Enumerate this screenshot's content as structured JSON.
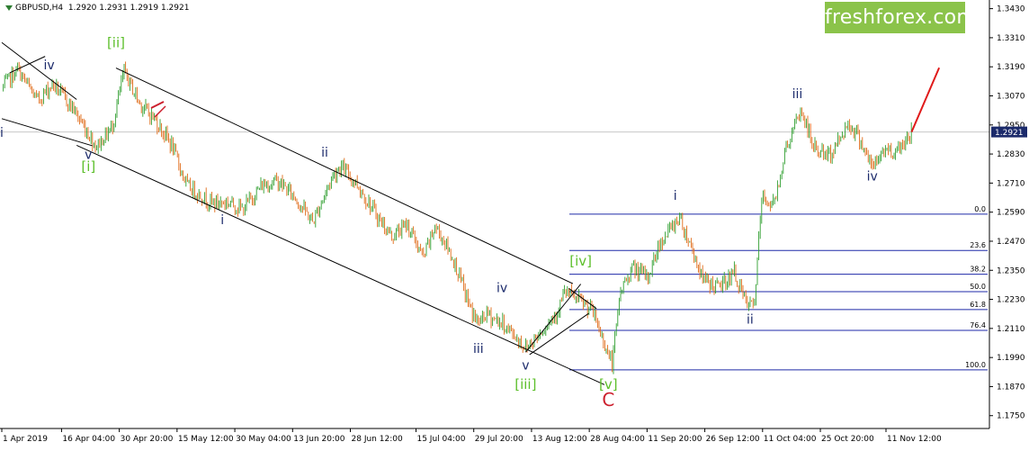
{
  "header": {
    "symbol": "GBPUSD,H4",
    "ohlc": "1.2920 1.2931 1.2919 1.2921",
    "brand": "freshforex.com"
  },
  "colors": {
    "bull": "#2e9e2e",
    "bear": "#e06a16",
    "wave_navy": "#1b2a6b",
    "wave_green": "#5cbf2a",
    "wave_red": "#cc1f2d",
    "fib_line": "#1f2aa8",
    "projection": "#e01a1a",
    "channel": "#000000",
    "brand_bg": "#8bc34a"
  },
  "chart_data": {
    "type": "candlestick",
    "symbol": "GBPUSD",
    "timeframe": "H4",
    "last_price": 1.2921,
    "y_axis": {
      "min": 1.1697,
      "max": 1.3462,
      "ticks": [
        "1.3430",
        "1.3310",
        "1.3190",
        "1.3070",
        "1.2950",
        "1.2830",
        "1.2710",
        "1.2590",
        "1.2470",
        "1.2350",
        "1.2230",
        "1.2110",
        "1.1990",
        "1.1870",
        "1.1750"
      ]
    },
    "x_axis": {
      "ticks": [
        "1 Apr 2019",
        "16 Apr 04:00",
        "30 Apr 20:00",
        "15 May 12:00",
        "30 May 04:00",
        "13 Jun 20:00",
        "28 Jun 12:00",
        "15 Jul 04:00",
        "29 Jul 20:00",
        "13 Aug 12:00",
        "28 Aug 04:00",
        "11 Sep 20:00",
        "26 Sep 12:00",
        "11 Oct 04:00",
        "25 Oct 20:00",
        "11 Nov 12:00"
      ]
    },
    "price_path": [
      {
        "x": "1 Apr 2019",
        "y": 1.31
      },
      {
        "x": "5 Apr 2019",
        "y": 1.318
      },
      {
        "x": "10 Apr 2019",
        "y": 1.305
      },
      {
        "x": "14 Apr 2019",
        "y": 1.312
      },
      {
        "x": "19 Apr 2019",
        "y": 1.302
      },
      {
        "x": "25 Apr 2019",
        "y": 1.286
      },
      {
        "x": "29 Apr 2019",
        "y": 1.294
      },
      {
        "x": "2 May 2019",
        "y": 1.317
      },
      {
        "x": "6 May 2019",
        "y": 1.304
      },
      {
        "x": "10 May 2019",
        "y": 1.297
      },
      {
        "x": "14 May 2019",
        "y": 1.287
      },
      {
        "x": "18 May 2019",
        "y": 1.27
      },
      {
        "x": "24 May 2019",
        "y": 1.263
      },
      {
        "x": "29 May 2019",
        "y": 1.263
      },
      {
        "x": "1 Jun 2019",
        "y": 1.26
      },
      {
        "x": "6 Jun 2019",
        "y": 1.27
      },
      {
        "x": "10 Jun 2019",
        "y": 1.272
      },
      {
        "x": "14 Jun 2019",
        "y": 1.266
      },
      {
        "x": "19 Jun 2019",
        "y": 1.255
      },
      {
        "x": "24 Jun 2019",
        "y": 1.274
      },
      {
        "x": "26 Jun 2019",
        "y": 1.278
      },
      {
        "x": "30 Jun 2019",
        "y": 1.271
      },
      {
        "x": "5 Jul 2019",
        "y": 1.258
      },
      {
        "x": "9 Jul 2019",
        "y": 1.249
      },
      {
        "x": "13 Jul 2019",
        "y": 1.254
      },
      {
        "x": "17 Jul 2019",
        "y": 1.24
      },
      {
        "x": "20 Jul 2019",
        "y": 1.253
      },
      {
        "x": "22 Jul 2019",
        "y": 1.248
      },
      {
        "x": "25 Jul 2019",
        "y": 1.238
      },
      {
        "x": "29 Jul 2019",
        "y": 1.219
      },
      {
        "x": "31 Jul 2019",
        "y": 1.213
      },
      {
        "x": "2 Aug 2019",
        "y": 1.217
      },
      {
        "x": "6 Aug 2019",
        "y": 1.213
      },
      {
        "x": "8 Aug 2019",
        "y": 1.21
      },
      {
        "x": "12 Aug 2019",
        "y": 1.203
      },
      {
        "x": "15 Aug 2019",
        "y": 1.208
      },
      {
        "x": "20 Aug 2019",
        "y": 1.218
      },
      {
        "x": "22 Aug 2019",
        "y": 1.226
      },
      {
        "x": "26 Aug 2019",
        "y": 1.222
      },
      {
        "x": "29 Aug 2019",
        "y": 1.218
      },
      {
        "x": "3 Sep 2019",
        "y": 1.196
      },
      {
        "x": "5 Sep 2019",
        "y": 1.226
      },
      {
        "x": "8 Sep 2019",
        "y": 1.236
      },
      {
        "x": "12 Sep 2019",
        "y": 1.232
      },
      {
        "x": "15 Sep 2019",
        "y": 1.246
      },
      {
        "x": "20 Sep 2019",
        "y": 1.257
      },
      {
        "x": "23 Sep 2019",
        "y": 1.245
      },
      {
        "x": "26 Sep 2019",
        "y": 1.231
      },
      {
        "x": "30 Sep 2019",
        "y": 1.228
      },
      {
        "x": "4 Oct 2019",
        "y": 1.234
      },
      {
        "x": "7 Oct 2019",
        "y": 1.221
      },
      {
        "x": "9 Oct 2019",
        "y": 1.22
      },
      {
        "x": "11 Oct 2019",
        "y": 1.265
      },
      {
        "x": "14 Oct 2019",
        "y": 1.262
      },
      {
        "x": "17 Oct 2019",
        "y": 1.285
      },
      {
        "x": "21 Oct 2019",
        "y": 1.301
      },
      {
        "x": "24 Oct 2019",
        "y": 1.286
      },
      {
        "x": "28 Oct 2019",
        "y": 1.282
      },
      {
        "x": "31 Oct 2019",
        "y": 1.29
      },
      {
        "x": "2 Nov 2019",
        "y": 1.296
      },
      {
        "x": "5 Nov 2019",
        "y": 1.289
      },
      {
        "x": "8 Nov 2019",
        "y": 1.277
      },
      {
        "x": "11 Nov 2019",
        "y": 1.285
      },
      {
        "x": "14 Nov 2019",
        "y": 1.284
      },
      {
        "x": "18 Nov 2019",
        "y": 1.2921
      }
    ],
    "fibonacci": [
      {
        "label": "0.0",
        "price": 1.2582
      },
      {
        "label": "23.6",
        "price": 1.2432
      },
      {
        "label": "38.2",
        "price": 1.2334
      },
      {
        "label": "50.0",
        "price": 1.2262
      },
      {
        "label": "61.8",
        "price": 1.2188
      },
      {
        "label": "76.4",
        "price": 1.2102
      },
      {
        "label": "100.0",
        "price": 1.1939
      }
    ],
    "wave_labels": [
      {
        "text": "i",
        "color": "wave_navy",
        "x": "1 Apr 2019",
        "y": 1.29
      },
      {
        "text": "iv",
        "color": "wave_navy",
        "x": "13 Apr 2019",
        "y": 1.318
      },
      {
        "text": "v",
        "color": "wave_navy",
        "x": "23 Apr 2019",
        "y": 1.281
      },
      {
        "text": "[i]",
        "color": "wave_green",
        "x": "23 Apr 2019",
        "y": 1.276
      },
      {
        "text": "[ii]",
        "color": "wave_green",
        "x": "30 Apr 2019",
        "y": 1.327
      },
      {
        "text": "i",
        "color": "wave_navy",
        "x": "27 May 2019",
        "y": 1.254
      },
      {
        "text": "ii",
        "color": "wave_navy",
        "x": "22 Jun 2019",
        "y": 1.282
      },
      {
        "text": "iv",
        "color": "wave_navy",
        "x": "6 Aug 2019",
        "y": 1.226
      },
      {
        "text": "iii",
        "color": "wave_navy",
        "x": "31 Jul 2019",
        "y": 1.201
      },
      {
        "text": "v",
        "color": "wave_navy",
        "x": "12 Aug 2019",
        "y": 1.194
      },
      {
        "text": "[iii]",
        "color": "wave_green",
        "x": "12 Aug 2019",
        "y": 1.186
      },
      {
        "text": "[iv]",
        "color": "wave_green",
        "x": "26 Aug 2019",
        "y": 1.237
      },
      {
        "text": "[v]",
        "color": "wave_green",
        "x": "2 Sep 2019",
        "y": 1.186
      },
      {
        "text": "C",
        "color": "wave_red",
        "x": "2 Sep 2019",
        "y": 1.179
      },
      {
        "text": "i",
        "color": "wave_navy",
        "x": "19 Sep 2019",
        "y": 1.264
      },
      {
        "text": "ii",
        "color": "wave_navy",
        "x": "8 Oct 2019",
        "y": 1.213
      },
      {
        "text": "iii",
        "color": "wave_navy",
        "x": "20 Oct 2019",
        "y": 1.306
      },
      {
        "text": "iv",
        "color": "wave_navy",
        "x": "8 Nov 2019",
        "y": 1.272
      }
    ],
    "channel_lines": [
      {
        "from": {
          "x": "30 Apr 2019",
          "y": 1.3185
        },
        "to": {
          "x": "24 Aug 2019",
          "y": 1.2295
        }
      },
      {
        "from": {
          "x": "20 Apr 2019",
          "y": 1.2866
        },
        "to": {
          "x": "1 Sep 2019",
          "y": 1.1878
        }
      },
      {
        "from": {
          "x": "1 Apr 2019",
          "y": 1.329
        },
        "to": {
          "x": "20 Apr 2019",
          "y": 1.3055
        }
      },
      {
        "from": {
          "x": "1 Apr 2019",
          "y": 1.2976
        },
        "to": {
          "x": "24 Apr 2019",
          "y": 1.2864
        }
      },
      {
        "from": {
          "x": "3 Apr 2019",
          "y": 1.3165
        },
        "to": {
          "x": "12 Apr 2019",
          "y": 1.3233
        }
      },
      {
        "from": {
          "x": "12 Aug 2019",
          "y": 1.2012
        },
        "to": {
          "x": "26 Aug 2019",
          "y": 1.2293
        }
      },
      {
        "from": {
          "x": "13 Aug 2019",
          "y": 1.2002
        },
        "to": {
          "x": "28 Aug 2019",
          "y": 1.2172
        }
      },
      {
        "from": {
          "x": "23 Aug 2019",
          "y": 1.2275
        },
        "to": {
          "x": "30 Aug 2019",
          "y": 1.2192
        }
      }
    ],
    "projection": {
      "from": {
        "x": "18 Nov 2019",
        "y": 1.2921
      },
      "to": {
        "x": "25 Nov 2019",
        "y": 1.3186
      }
    }
  }
}
